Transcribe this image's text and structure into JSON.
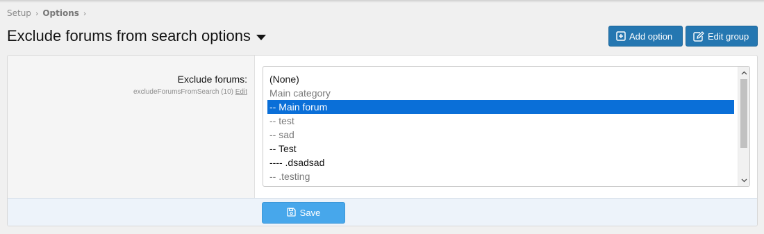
{
  "breadcrumb": {
    "items": [
      {
        "label": "Setup"
      },
      {
        "label": "Options"
      }
    ],
    "separator": "›"
  },
  "header": {
    "title": "Exclude forums from search options",
    "add_option_label": "Add option",
    "edit_group_label": "Edit group"
  },
  "field": {
    "label": "Exclude forums:",
    "hint": "excludeForumsFromSearch (10)",
    "edit_link": "Edit"
  },
  "listbox": {
    "options": [
      {
        "text": "(None)",
        "style": "dark",
        "selected": false
      },
      {
        "text": "Main category",
        "style": "gray",
        "selected": false
      },
      {
        "text": "-- Main forum",
        "style": "dark",
        "selected": true
      },
      {
        "text": "-- test",
        "style": "gray",
        "selected": false
      },
      {
        "text": "-- sad",
        "style": "gray",
        "selected": false
      },
      {
        "text": "-- Test",
        "style": "dark",
        "selected": false
      },
      {
        "text": "---- .dsadsad",
        "style": "dark",
        "selected": false
      },
      {
        "text": "-- .testing",
        "style": "gray",
        "selected": false
      }
    ]
  },
  "footer": {
    "save_label": "Save"
  },
  "colors": {
    "primary_button": "#2577b1",
    "save_button": "#47a7eb",
    "selected_option": "#0a6fd8"
  }
}
